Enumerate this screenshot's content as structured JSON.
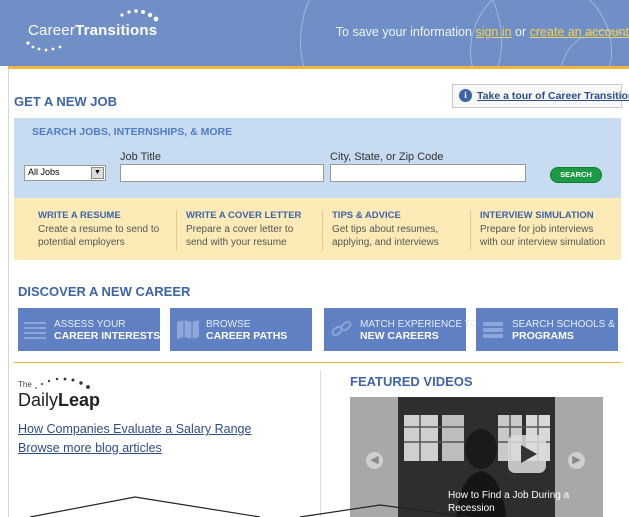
{
  "header": {
    "logo_light": "Career",
    "logo_bold": "Transitions",
    "msg_prefix": "To save your information ",
    "sign_in": "sign in",
    "msg_or": " or ",
    "create_account": "create an account"
  },
  "get_job": {
    "title": "GET A NEW JOB",
    "tour_link": "Take a tour of Career Transitions",
    "search_heading": "SEARCH JOBS, INTERNSHIPS, & MORE",
    "job_title_label": "Job Title",
    "location_label": "City, State, or Zip Code",
    "job_type_selected": "All Jobs",
    "job_title_value": "",
    "location_value": "",
    "search_button": "SEARCH"
  },
  "tools": [
    {
      "title": "WRITE A RESUME",
      "desc1": "Create a resume to send to",
      "desc2": "potential employers"
    },
    {
      "title": "WRITE A COVER LETTER",
      "desc1": "Prepare a cover letter to",
      "desc2": "send with your resume"
    },
    {
      "title": "TIPS & ADVICE",
      "desc1": "Get tips about resumes,",
      "desc2": "applying, and interviews"
    },
    {
      "title": "INTERVIEW SIMULATION",
      "desc1": "Prepare for job interviews",
      "desc2": "with our interview simulation"
    }
  ],
  "discover": {
    "title": "DISCOVER A NEW CAREER",
    "buttons": [
      {
        "line1": "ASSESS YOUR",
        "line2": "CAREER INTERESTS"
      },
      {
        "line1": "BROWSE",
        "line2": "CAREER PATHS"
      },
      {
        "line1": "MATCH EXPERIENCE TO",
        "line2": "NEW CAREERS"
      },
      {
        "line1": "SEARCH SCHOOLS &",
        "line2": "PROGRAMS"
      }
    ]
  },
  "blog": {
    "the": "The",
    "daily": "Daily",
    "leap": "Leap",
    "article_link": "How Companies Evaluate a Salary Range",
    "more_link": "Browse more blog articles"
  },
  "videos": {
    "title": "FEATURED VIDEOS",
    "caption_line1": "How to Find a Job During a",
    "caption_line2": "Recession"
  },
  "colors": {
    "header_blue": "#6f8fc6",
    "accent_orange": "#f2b53c",
    "search_panel": "#c7dbf1",
    "tools_panel": "#fcebb6",
    "button_blue": "#5f80c2",
    "search_green": "#1d9a45",
    "link_blue": "#2d4d8a"
  }
}
